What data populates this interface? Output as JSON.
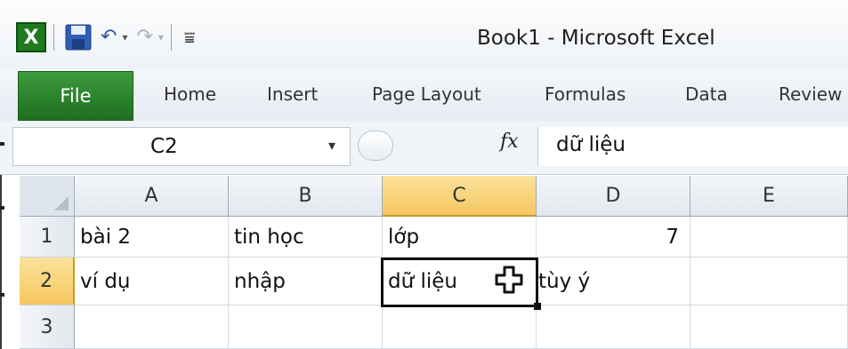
{
  "window": {
    "title": "Book1  -  Microsoft Excel"
  },
  "qat": {
    "app_icon": "X",
    "icons": [
      "excel-app-icon",
      "save-icon",
      "undo-icon",
      "redo-icon",
      "customize-qat-icon"
    ],
    "undo_glyph": "↶",
    "redo_glyph": "↷",
    "dropdown_glyph": "▾",
    "customize_glyph": "⩸"
  },
  "ribbon": {
    "tabs": [
      "File",
      "Home",
      "Insert",
      "Page Layout",
      "Formulas",
      "Data",
      "Review"
    ]
  },
  "formula_bar": {
    "name_box": "C2",
    "dropdown_glyph": "▾",
    "fx_label": "fx",
    "formula": "dữ liệu"
  },
  "sheet": {
    "columns": [
      "A",
      "B",
      "C",
      "D",
      "E"
    ],
    "selected_column": "C",
    "selected_row": "2",
    "rows": [
      {
        "header": "1",
        "cells": [
          "bài 2",
          "tin học",
          "lớp",
          "7",
          ""
        ]
      },
      {
        "header": "2",
        "cells": [
          "ví dụ",
          "nhập",
          "dữ liệu",
          "tùy ý",
          ""
        ]
      },
      {
        "header": "3",
        "cells": [
          "",
          "",
          "",
          "",
          ""
        ]
      }
    ]
  },
  "colors": {
    "file_tab": "#2a7f2a",
    "selection_header": "#f5c760",
    "accent": "#2c5aa0"
  }
}
